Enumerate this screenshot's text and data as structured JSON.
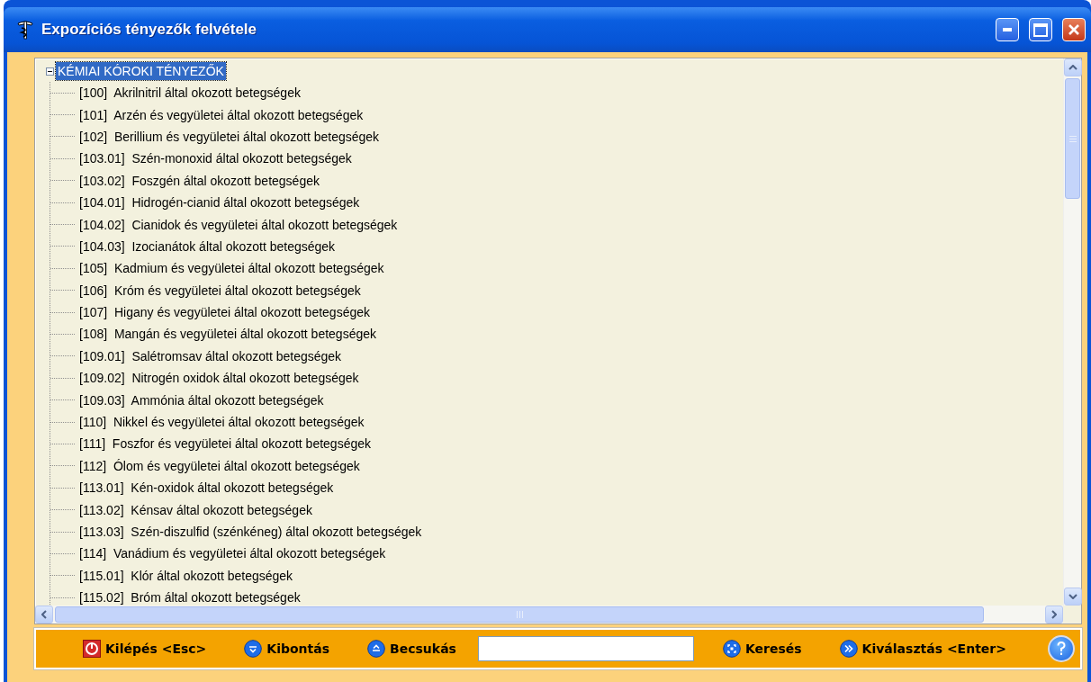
{
  "window": {
    "title": "Expozíciós tényezők felvétele"
  },
  "tree": {
    "root": {
      "label": "KÉMIAI KÓROKI TÉNYEZŐK",
      "expanded": true,
      "selected": true,
      "children": [
        {
          "label": "[100]  Akrilnitril által okozott betegségek",
          "selected": false
        },
        {
          "label": "[101]  Arzén és vegyületei által okozott betegségek",
          "selected": false
        },
        {
          "label": "[102]  Berillium és vegyületei által okozott betegségek",
          "selected": false
        },
        {
          "label": "[103.01]  Szén-monoxid által okozott betegségek",
          "selected": false
        },
        {
          "label": "[103.02]  Foszgén által okozott betegségek",
          "selected": false
        },
        {
          "label": "[104.01]  Hidrogén-cianid által okozott betegségek",
          "selected": false
        },
        {
          "label": "[104.02]  Cianidok és vegyületei által okozott betegségek",
          "selected": false
        },
        {
          "label": "[104.03]  Izocianátok által okozott betegségek",
          "selected": false
        },
        {
          "label": "[105]  Kadmium és vegyületei által okozott betegségek",
          "selected": false
        },
        {
          "label": "[106]  Króm és vegyületei által okozott betegségek",
          "selected": false
        },
        {
          "label": "[107]  Higany és vegyületei által okozott betegségek",
          "selected": false
        },
        {
          "label": "[108]  Mangán és vegyületei által okozott betegségek",
          "selected": false
        },
        {
          "label": "[109.01]  Salétromsav által okozott betegségek",
          "selected": false
        },
        {
          "label": "[109.02]  Nitrogén oxidok által okozott betegségek",
          "selected": false
        },
        {
          "label": "[109.03]  Ammónia által okozott betegségek",
          "selected": false
        },
        {
          "label": "[110]  Nikkel és vegyületei által okozott betegségek",
          "selected": false
        },
        {
          "label": "[111]  Foszfor és vegyületei által okozott betegségek",
          "selected": false
        },
        {
          "label": "[112]  Ólom és vegyületei által okozott betegségek",
          "selected": false
        },
        {
          "label": "[113.01]  Kén-oxidok által okozott betegségek",
          "selected": false
        },
        {
          "label": "[113.02]  Kénsav által okozott betegségek",
          "selected": false
        },
        {
          "label": "[113.03]  Szén-diszulfid (szénkéneg) által okozott betegségek",
          "selected": false
        },
        {
          "label": "[114]  Vanádium és vegyületei által okozott betegségek",
          "selected": false
        },
        {
          "label": "[115.01]  Klór által okozott betegségek",
          "selected": false
        },
        {
          "label": "[115.02]  Bróm által okozott betegségek",
          "selected": false
        }
      ]
    }
  },
  "toolbar": {
    "left_buttons": [
      {
        "label": "Kilépés <Esc>",
        "kind": "exit"
      },
      {
        "label": "Kibontás",
        "kind": "expand"
      },
      {
        "label": "Becsukás",
        "kind": "collapse"
      }
    ],
    "right_buttons": [
      {
        "label": "Keresés",
        "kind": "search"
      },
      {
        "label": "Kiválasztás <Enter>",
        "kind": "select"
      }
    ]
  }
}
